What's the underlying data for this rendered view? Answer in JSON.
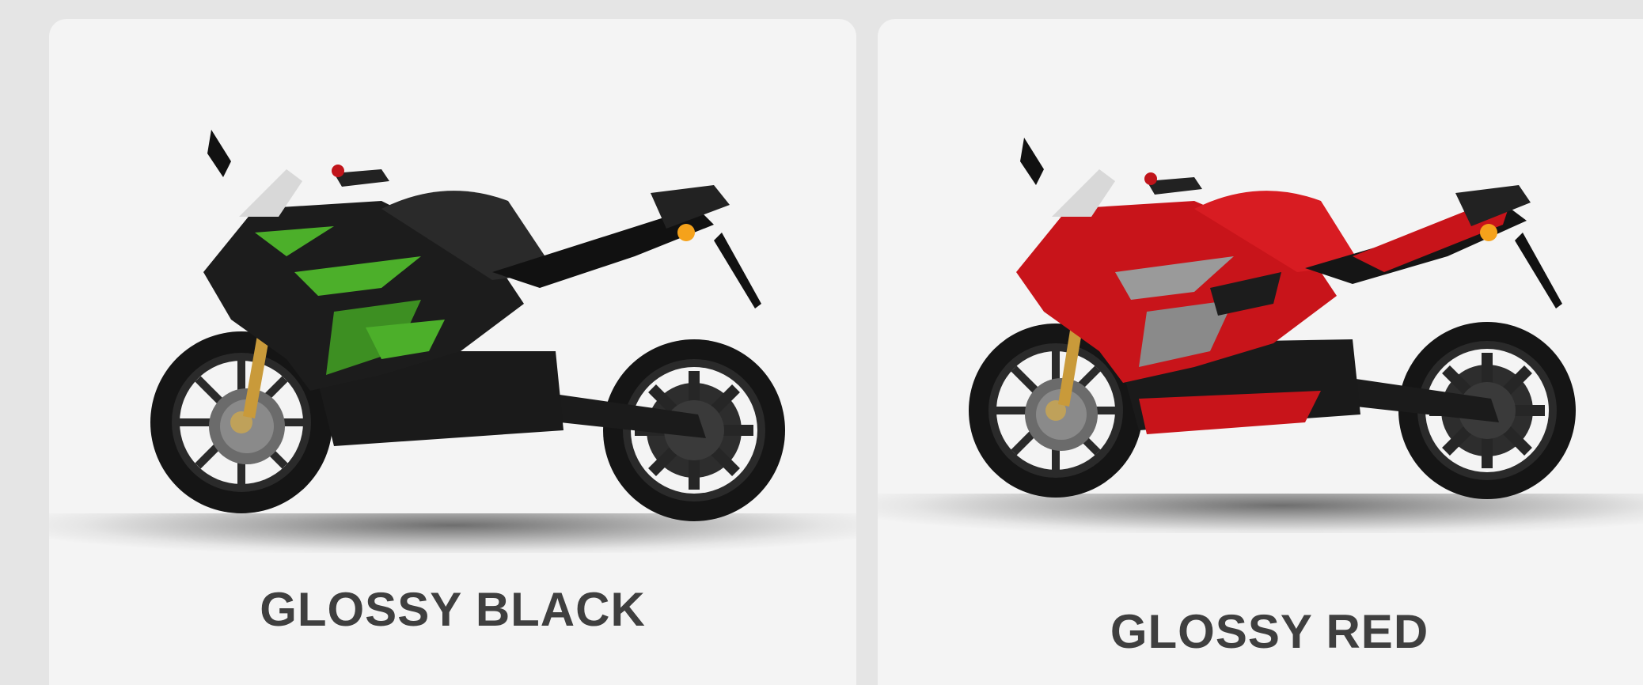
{
  "variants": [
    {
      "label": "GLOSSY BLACK",
      "body_color": "#1c1c1c",
      "accent_color": "#4caf2a"
    },
    {
      "label": "GLOSSY RED",
      "body_color": "#c8141a",
      "accent_color": "#9a9a9a"
    }
  ],
  "colors": {
    "page_background": "#e5e5e5",
    "card_background": "#f4f4f4",
    "label_text": "#3f3f3f",
    "indicator": "#f5a21b"
  }
}
